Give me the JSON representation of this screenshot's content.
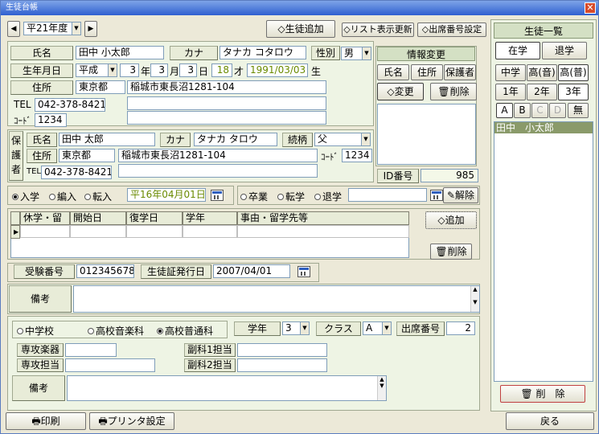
{
  "title": "生徒台帳",
  "close": "✕",
  "nav": {
    "prev": "◀",
    "next": "▶",
    "year": "平21年度",
    "add_student": "生徒追加",
    "refresh": "リスト表示更新",
    "seat_setting": "出席番号設定"
  },
  "student": {
    "name_label": "氏名",
    "name": "田中 小太郎",
    "kana_label": "カナ",
    "kana": "タナカ コタロウ",
    "sex_label": "性別",
    "sex": "男",
    "birth_label": "生年月日",
    "era": "平成",
    "year": "3",
    "year_unit": "年",
    "month": "3",
    "month_unit": "月",
    "day": "3",
    "day_unit": "日",
    "age": "18",
    "age_unit": "才",
    "birth_iso": "1991/03/03",
    "birth_suffix": "生",
    "addr_label": "住所",
    "pref": "東京都",
    "addr": "稲城市東長沼1281-104",
    "tel_label": "TEL",
    "tel": "042-378-8421",
    "code_label": "ｺｰﾄﾞ",
    "code": "1234"
  },
  "info": {
    "title": "情報変更",
    "tabs": [
      "氏名",
      "住所",
      "保護者"
    ],
    "change": "変更",
    "delete": "削除",
    "id_label": "ID番号",
    "id": "985"
  },
  "guardian": {
    "side": [
      "保",
      "護",
      "者"
    ],
    "name_label": "氏名",
    "name": "田中 太郎",
    "kana_label": "カナ",
    "kana": "タナカ タロウ",
    "rel_label": "続柄",
    "rel": "父",
    "addr_label": "住所",
    "pref": "東京都",
    "addr": "稲城市東長沼1281-104",
    "code_label": "ｺｰﾄﾞ",
    "code": "1234",
    "tel_label": "TEL",
    "tel": "042-378-8421"
  },
  "enroll": {
    "options": [
      "入学",
      "編入",
      "転入"
    ],
    "date": "平16年04月01日",
    "exit_options": [
      "卒業",
      "転学",
      "退学"
    ],
    "release": "解除"
  },
  "leave": {
    "headers": [
      "休学・留学",
      "開始日",
      "復学日",
      "学年",
      "事由・留学先等"
    ],
    "add": "追加",
    "delete": "削除"
  },
  "exam": {
    "label": "受験番号",
    "value": "0123456789",
    "issue_label": "生徒証発行日",
    "issue": "2007/04/01"
  },
  "remark1": {
    "label": "備考"
  },
  "course": {
    "options": [
      "中学校",
      "高校音楽科",
      "高校普通科"
    ],
    "grade_label": "学年",
    "grade": "3",
    "class_label": "クラス",
    "class": "A",
    "seat_label": "出席番号",
    "seat": "2"
  },
  "teachers": {
    "major_inst": "専攻楽器",
    "major_teacher": "専攻担当",
    "minor1": "副科1担当",
    "minor2": "副科2担当"
  },
  "remark2": {
    "label": "備考"
  },
  "bottom": {
    "print": "印刷",
    "printer": "プリンタ設定",
    "back": "戻る"
  },
  "list": {
    "title": "生徒一覧",
    "status": [
      "在学",
      "退学"
    ],
    "school": [
      "中学",
      "高(音)",
      "高(普)"
    ],
    "grades": [
      "1年",
      "2年",
      "3年"
    ],
    "classes": [
      "A",
      "B",
      "C",
      "D",
      "無"
    ],
    "students": [
      "田中　小太郎"
    ],
    "delete": "削　除"
  },
  "colors": {
    "accent": "#6a8a00",
    "selected_row": "#8a9a6a"
  }
}
